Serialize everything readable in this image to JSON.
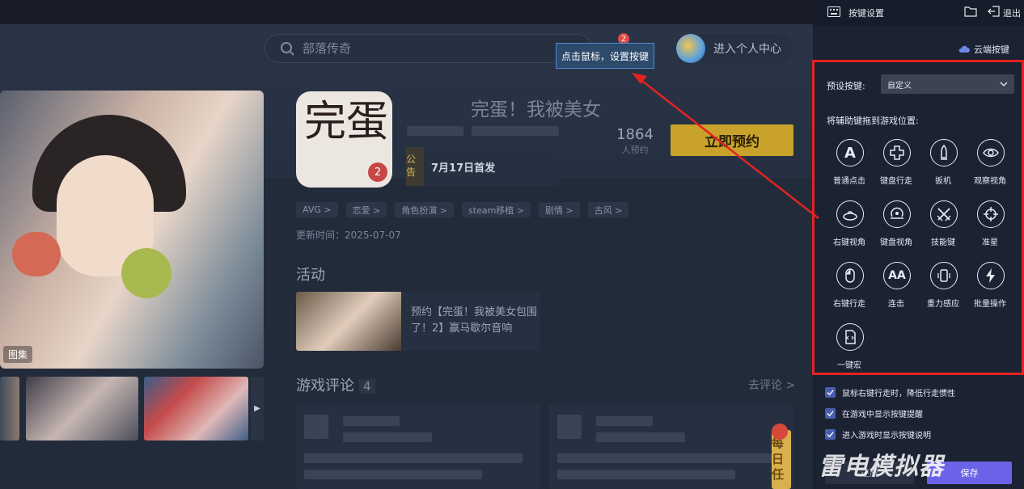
{
  "background_app": {
    "search": {
      "placeholder": "部落传奇"
    },
    "notification_count": "2",
    "tooltip": "点击鼠标，设置按键",
    "user_center": "进入个人中心",
    "hero": {
      "gallery_label": "图集"
    },
    "game": {
      "icon_text": "完蛋",
      "icon_number": "2",
      "title": "完蛋！我被美女",
      "announcement": {
        "label": "公告",
        "text": "7月17日首发"
      },
      "reserve_count": "1864",
      "reserve_count_label": "人预约",
      "reserve_button": "立即预约",
      "tags": [
        "AVG >",
        "恋爱 >",
        "角色扮演 >",
        "steam移植 >",
        "剧情 >",
        "古风 >"
      ],
      "update_time": "更新时间：2025-07-07"
    },
    "activity": {
      "title": "活动",
      "card_text": "预约【完蛋！我被美女包围了！2】赢马歇尔音响"
    },
    "reviews": {
      "title": "游戏评论",
      "count": "4",
      "more": "去评论 >"
    },
    "daily": "每日任",
    "watermark": "雷电模拟器"
  },
  "keymap_panel": {
    "title": "按键设置",
    "exit_label": "退出",
    "cloud_label": "云端按键",
    "preset_label": "预设按键:",
    "preset_value": "自定义",
    "drag_hint": "将辅助键拖到游戏位置:",
    "keys": [
      {
        "label": "普通点击",
        "icon": "letter-a-icon"
      },
      {
        "label": "键盘行走",
        "icon": "dpad-icon"
      },
      {
        "label": "扳机",
        "icon": "bullet-icon"
      },
      {
        "label": "观察视角",
        "icon": "eye-icon"
      },
      {
        "label": "右键视角",
        "icon": "rotate-view-icon"
      },
      {
        "label": "键盘视角",
        "icon": "orbit-icon"
      },
      {
        "label": "技能键",
        "icon": "crossed-swords-icon"
      },
      {
        "label": "准星",
        "icon": "crosshair-icon"
      },
      {
        "label": "右键行走",
        "icon": "mouse-icon"
      },
      {
        "label": "连击",
        "icon": "double-a-icon"
      },
      {
        "label": "重力感应",
        "icon": "phone-tilt-icon"
      },
      {
        "label": "批量操作",
        "icon": "lightning-icon"
      },
      {
        "label": "一键宏",
        "icon": "macro-script-icon"
      }
    ],
    "options": [
      {
        "label": "鼠标右键行走时，降低行走惯性",
        "checked": true
      },
      {
        "label": "在游戏中显示按键提醒",
        "checked": true
      },
      {
        "label": "进入游戏时显示按键说明",
        "checked": true
      }
    ],
    "cancel_button": "还原",
    "save_button": "保存"
  },
  "colors": {
    "highlight_frame": "#e52222",
    "reserve_button": "#c9a22c",
    "save_button": "#6a63e8"
  }
}
